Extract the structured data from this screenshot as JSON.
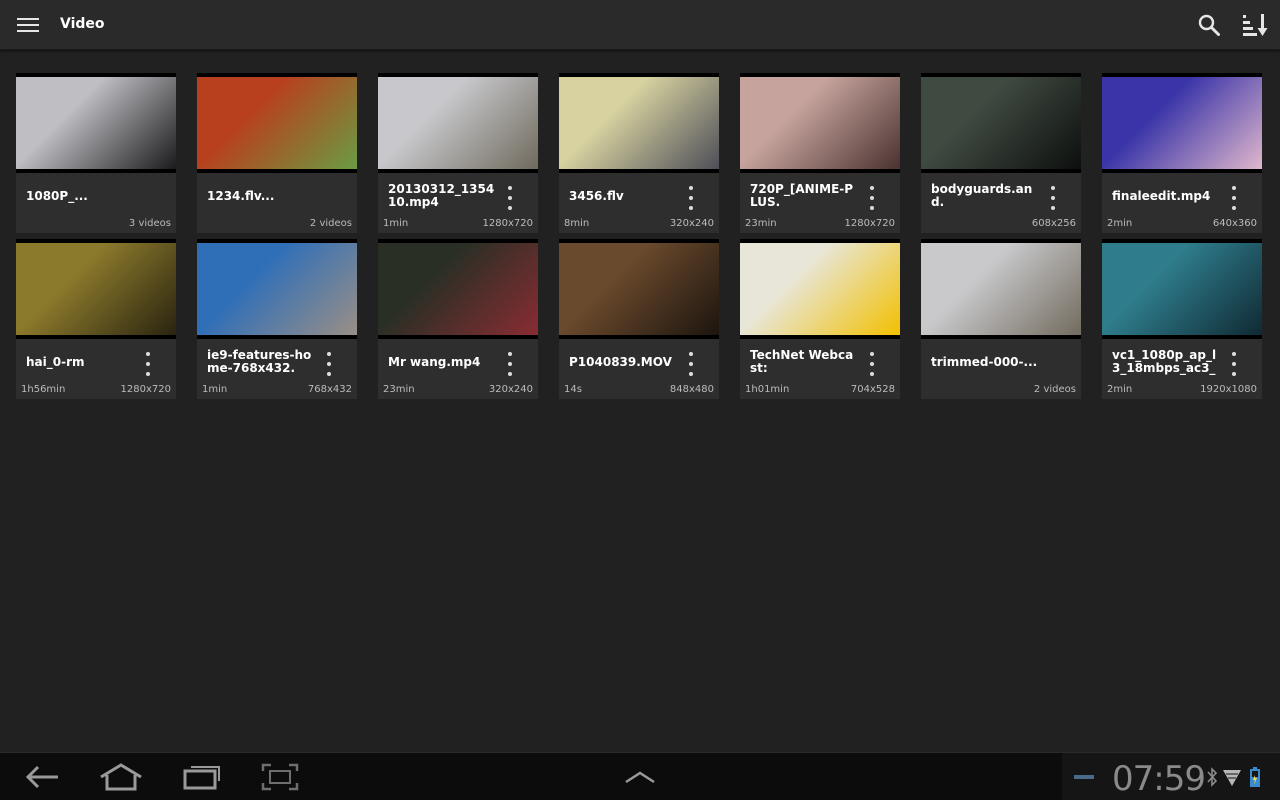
{
  "app": {
    "title": "Video"
  },
  "topbar": {
    "menu_icon": "menu-icon",
    "search_icon": "search-icon",
    "sort_icon": "sort-icon"
  },
  "videos": [
    {
      "name": "1080P_...",
      "left": "",
      "right": "3 videos",
      "menu": false,
      "thumb_colors": [
        "#bfbfc3",
        "#1b1b1d"
      ]
    },
    {
      "name": "1234.flv...",
      "left": "",
      "right": "2 videos",
      "menu": false,
      "thumb_colors": [
        "#b8401e",
        "#6a9c43"
      ]
    },
    {
      "name": "20130312_135410.mp4",
      "left": "1min",
      "right": "1280x720",
      "menu": true,
      "thumb_colors": [
        "#c8c8cc",
        "#6f6a5d"
      ]
    },
    {
      "name": "3456.flv",
      "left": "8min",
      "right": "320x240",
      "menu": true,
      "thumb_colors": [
        "#d7d2a0",
        "#4e4e58"
      ]
    },
    {
      "name": "720P_[ANIME-PLUS.",
      "left": "23min",
      "right": "1280x720",
      "menu": true,
      "thumb_colors": [
        "#c6a39d",
        "#4a3230"
      ]
    },
    {
      "name": "bodyguards.and.",
      "left": "",
      "right": "608x256",
      "menu": true,
      "thumb_colors": [
        "#3f4a41",
        "#0d0f0e"
      ]
    },
    {
      "name": "finaleedit.mp4",
      "left": "2min",
      "right": "640x360",
      "menu": true,
      "thumb_colors": [
        "#3a34a8",
        "#e0b8cc"
      ]
    },
    {
      "name": "hai_0-rm",
      "left": "1h56min",
      "right": "1280x720",
      "menu": true,
      "thumb_colors": [
        "#8c7a2c",
        "#2a2410"
      ]
    },
    {
      "name": "ie9-features-home-768x432.",
      "left": "1min",
      "right": "768x432",
      "menu": true,
      "thumb_colors": [
        "#2f6fb8",
        "#9a8f86"
      ]
    },
    {
      "name": "Mr wang.mp4",
      "left": "23min",
      "right": "320x240",
      "menu": true,
      "thumb_colors": [
        "#2a2f25",
        "#8a2c33"
      ]
    },
    {
      "name": "P1040839.MOV",
      "left": "14s",
      "right": "848x480",
      "menu": true,
      "thumb_colors": [
        "#6a4a2c",
        "#1d150f"
      ]
    },
    {
      "name": "TechNet Webcast:",
      "left": "1h01min",
      "right": "704x528",
      "menu": true,
      "thumb_colors": [
        "#e8e6d8",
        "#f2c000"
      ]
    },
    {
      "name": "trimmed-000-...",
      "left": "",
      "right": "2 videos",
      "menu": false,
      "thumb_colors": [
        "#c9c9cc",
        "#726b5e"
      ]
    },
    {
      "name": "vc1_1080p_ap_l3_18mbps_ac3_",
      "left": "2min",
      "right": "1920x1080",
      "menu": true,
      "thumb_colors": [
        "#2f7c8c",
        "#0f2a33"
      ]
    }
  ],
  "systembar": {
    "clock": "07:59",
    "back_icon": "back-icon",
    "home_icon": "home-icon",
    "recents_icon": "recent-apps-icon",
    "screenshot_icon": "screenshot-icon",
    "up_icon": "chevron-up-icon",
    "bluetooth_icon": "bluetooth-icon",
    "wifi_icon": "wifi-icon",
    "battery_icon": "battery-icon"
  }
}
